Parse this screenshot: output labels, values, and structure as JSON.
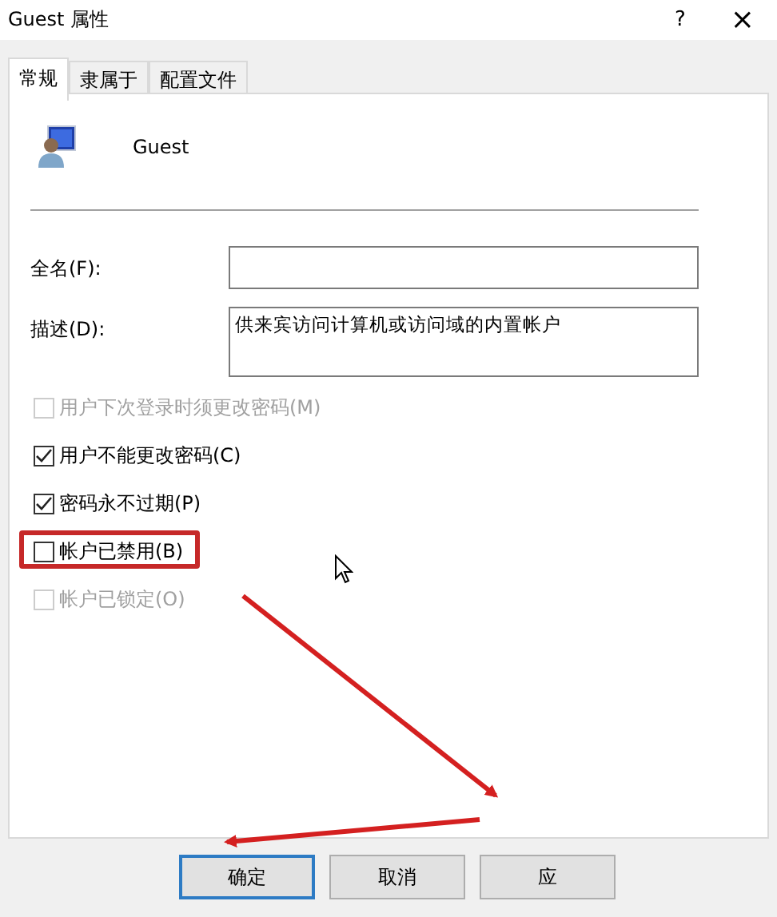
{
  "window": {
    "title": "Guest 属性",
    "help": "?",
    "close": "×"
  },
  "tabs": [
    {
      "label": "常规",
      "selected": true
    },
    {
      "label": "隶属于",
      "selected": false
    },
    {
      "label": "配置文件",
      "selected": false
    }
  ],
  "user": {
    "name": "Guest"
  },
  "fields": [
    {
      "label": "全名(F):",
      "multiline": false
    },
    {
      "label": "描述(D):",
      "value": "供来宾访问计算机或访问域的内置帐户",
      "multiline": true
    }
  ],
  "checkboxes": [
    {
      "label": "用户下次登录时须更改密码(M)",
      "checked": false,
      "disabled": true,
      "highlighted": false
    },
    {
      "label": "用户不能更改密码(C)",
      "checked": true,
      "disabled": false,
      "highlighted": false
    },
    {
      "label": "密码永不过期(P)",
      "checked": true,
      "disabled": false,
      "highlighted": false
    },
    {
      "label": "帐户已禁用(B)",
      "checked": false,
      "disabled": false,
      "highlighted": true
    },
    {
      "label": "帐户已锁定(O)",
      "checked": false,
      "disabled": true,
      "highlighted": false
    }
  ],
  "buttons": [
    {
      "label": "确定",
      "default": true
    },
    {
      "label": "取消",
      "default": false
    },
    {
      "label": "应",
      "default": false
    }
  ]
}
